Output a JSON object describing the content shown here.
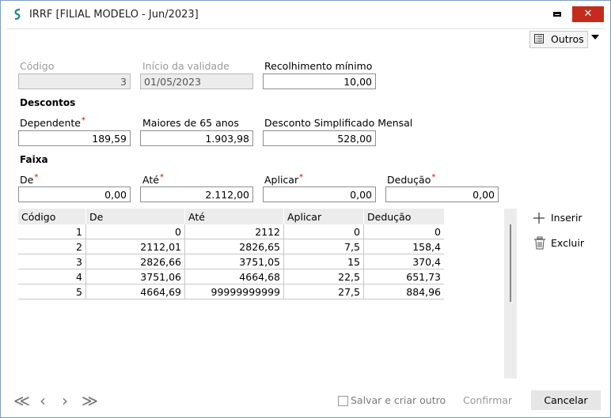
{
  "window": {
    "title": "IRRF [FILIAL MODELO - Jun/2023]",
    "close_glyph": "✕",
    "accent_close": "#c42b1c"
  },
  "toolbar": {
    "outros_label": "Outros"
  },
  "header_fields": {
    "codigo_label": "Código",
    "codigo_value": "3",
    "inicio_label": "Início da validade",
    "inicio_value": "01/05/2023",
    "recolhimento_label": "Recolhimento mínimo",
    "recolhimento_value": "10,00"
  },
  "descontos": {
    "section_label": "Descontos",
    "dependente_label": "Dependente",
    "dependente_value": "189,59",
    "maiores65_label": "Maiores de 65 anos",
    "maiores65_value": "1.903,98",
    "simplificado_label": "Desconto Simplificado Mensal",
    "simplificado_value": "528,00"
  },
  "faixa": {
    "section_label": "Faixa",
    "de_label": "De",
    "de_value": "0,00",
    "ate_label": "Até",
    "ate_value": "2.112,00",
    "aplicar_label": "Aplicar",
    "aplicar_value": "0,00",
    "deducao_label": "Dedução",
    "deducao_value": "0,00"
  },
  "grid": {
    "columns": [
      "Código",
      "De",
      "Até",
      "Aplicar",
      "Dedução"
    ],
    "rows": [
      [
        "1",
        "0",
        "2112",
        "0",
        "0"
      ],
      [
        "2",
        "2112,01",
        "2826,65",
        "7,5",
        "158,4"
      ],
      [
        "3",
        "2826,66",
        "3751,05",
        "15",
        "370,4"
      ],
      [
        "4",
        "3751,06",
        "4664,68",
        "22,5",
        "651,73"
      ],
      [
        "5",
        "4664,69",
        "99999999999",
        "27,5",
        "884,96"
      ]
    ]
  },
  "actions": {
    "inserir_label": "Inserir",
    "excluir_label": "Excluir"
  },
  "footer": {
    "nav_first": "≪",
    "nav_prev": "‹",
    "nav_next": "›",
    "nav_last": "≫",
    "salvar_label": "Salvar e criar outro",
    "confirmar_label": "Confirmar",
    "cancelar_label": "Cancelar"
  }
}
